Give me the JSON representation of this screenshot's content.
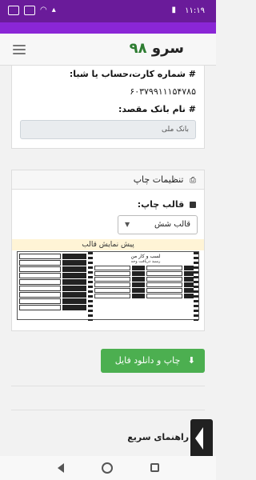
{
  "status_bar": {
    "time": "۱۱:۱۹"
  },
  "header": {
    "logo_word": "سرو",
    "logo_number": "۹۸"
  },
  "account": {
    "card_label": "# شماره کارت،حساب یا شبا:",
    "card_value": "۶۰۳۷۹۹۱۱۱۵۴۷۸۵",
    "bank_label": "# نام بانک مقصد:",
    "bank_value": "بانک ملی"
  },
  "print_settings": {
    "title": "تنظیمات چاپ",
    "template_label": "قالب چاپ:",
    "template_selected": "قالب شش",
    "preview_label": "پیش نمایش قالب",
    "receipt_title": "لسب و کار من",
    "receipt_subtitle": "رسید دریافت وجه"
  },
  "actions": {
    "download_label": "چاپ و دانلود فایل"
  },
  "guide": {
    "title": "راهنمای سریع"
  },
  "icons": {
    "printer": "printer-icon",
    "download": "download-icon",
    "menu": "hamburger-icon",
    "question": "question-icon"
  }
}
